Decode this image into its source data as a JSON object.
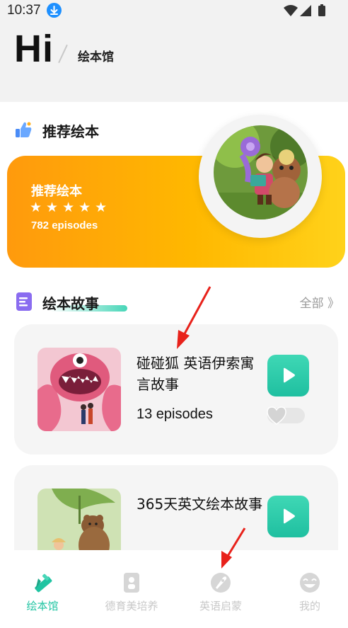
{
  "status_bar": {
    "time": "10:37",
    "icons": [
      "download-icon",
      "wifi-icon",
      "signal-icon",
      "battery-icon"
    ]
  },
  "header": {
    "greeting": "Hi",
    "section": "绘本馆"
  },
  "recommended": {
    "section_title": "推荐绘本",
    "card_title": "推荐绘本",
    "stars": "★★★★★",
    "episodes": "782 episodes"
  },
  "stories": {
    "section_title": "绘本故事",
    "see_all": "全部 》",
    "items": [
      {
        "title": "碰碰狐 英语伊索寓言故事",
        "episodes": "13 episodes"
      },
      {
        "title": "365天英文绘本故事",
        "episodes": ""
      }
    ]
  },
  "bottom_nav": {
    "items": [
      {
        "label": "绘本馆",
        "icon": "pencil-ruler-icon",
        "active": true
      },
      {
        "label": "德育美培养",
        "icon": "book-icon",
        "active": false
      },
      {
        "label": "英语启蒙",
        "icon": "rocket-icon",
        "active": false
      },
      {
        "label": "我的",
        "icon": "smiley-icon",
        "active": false
      }
    ]
  },
  "colors": {
    "accent": "#20c4a2",
    "card_gradient_start": "#ff9a0d",
    "card_gradient_end": "#ffd21a",
    "annotation_arrow": "#e8221b"
  }
}
